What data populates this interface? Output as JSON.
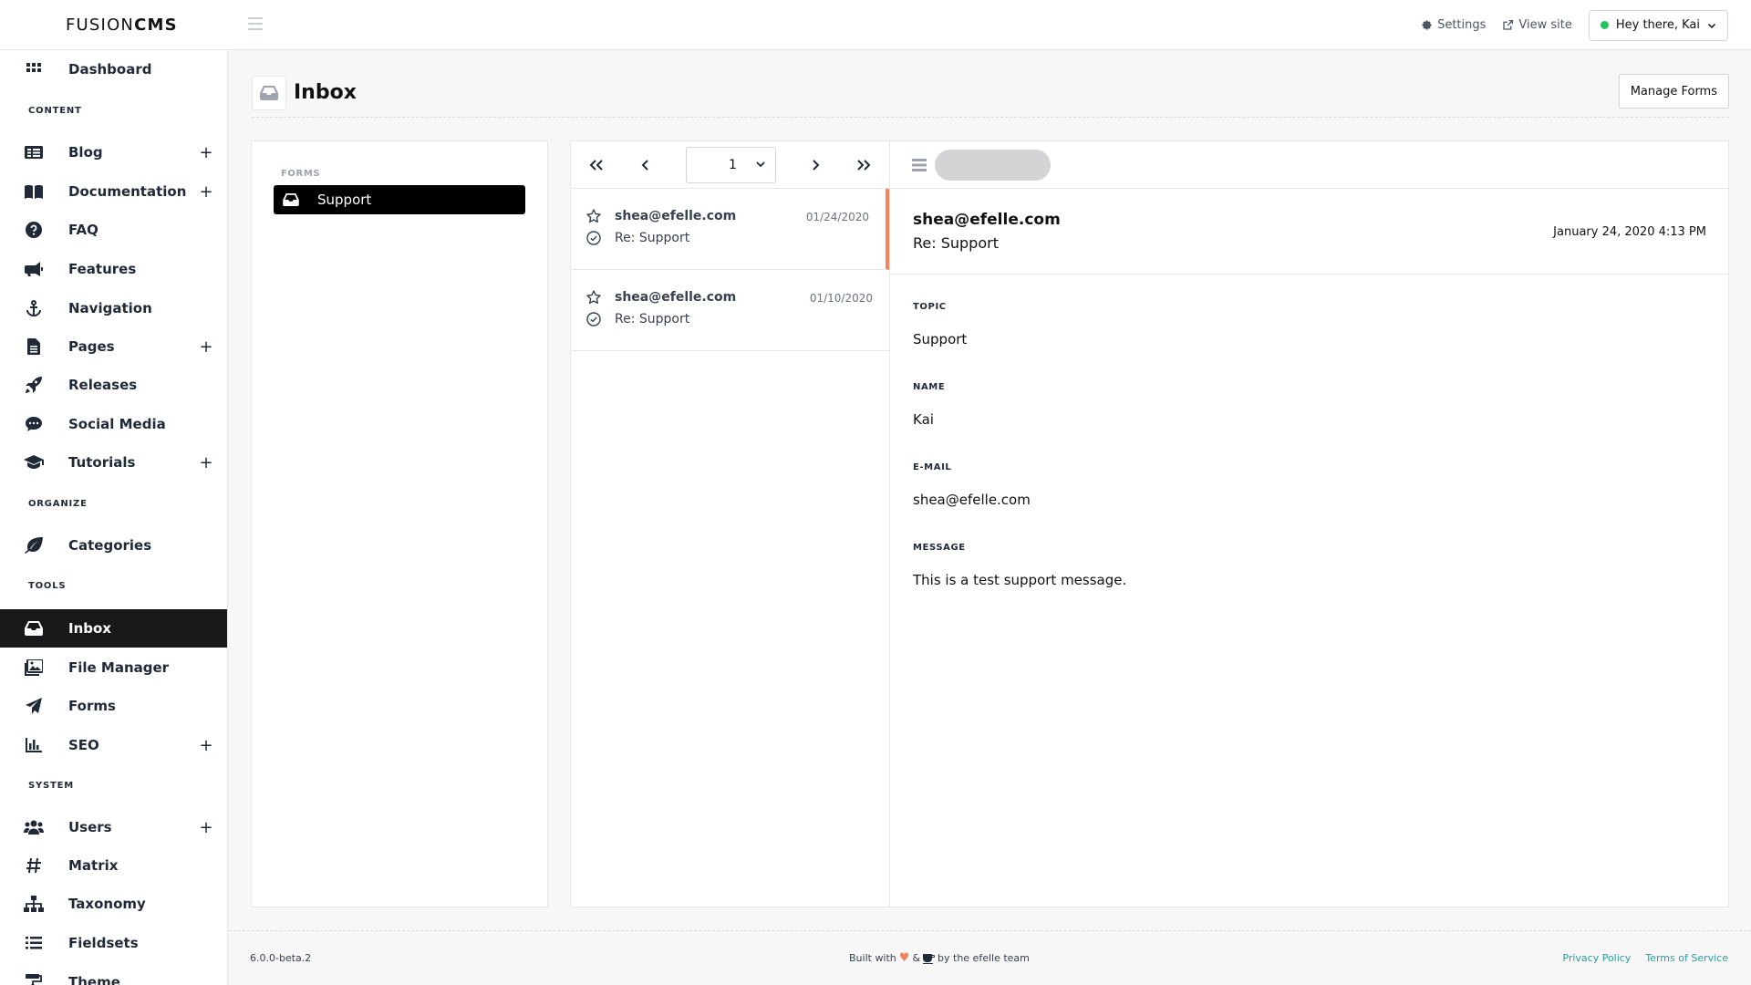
{
  "header": {
    "brand_light": "FUSION",
    "brand_bold": "CMS",
    "settings_label": "Settings",
    "view_site_label": "View site",
    "user_greeting": "Hey there, Kai"
  },
  "sidebar": {
    "dashboard": "Dashboard",
    "sections": {
      "content": "CONTENT",
      "organize": "ORGANIZE",
      "tools": "TOOLS",
      "system": "SYSTEM"
    },
    "content_items": [
      {
        "label": "Blog",
        "icon": "blog-icon",
        "has_add": true
      },
      {
        "label": "Documentation",
        "icon": "book-icon",
        "has_add": true
      },
      {
        "label": "FAQ",
        "icon": "question-icon",
        "has_add": false
      },
      {
        "label": "Features",
        "icon": "megaphone-icon",
        "has_add": false
      },
      {
        "label": "Navigation",
        "icon": "anchor-icon",
        "has_add": false
      },
      {
        "label": "Pages",
        "icon": "file-icon",
        "has_add": true
      },
      {
        "label": "Releases",
        "icon": "rocket-icon",
        "has_add": false
      },
      {
        "label": "Social Media",
        "icon": "comment-icon",
        "has_add": false
      },
      {
        "label": "Tutorials",
        "icon": "graduation-cap-icon",
        "has_add": true
      }
    ],
    "organize_items": [
      {
        "label": "Categories",
        "icon": "leaf-icon"
      }
    ],
    "tools_items": [
      {
        "label": "Inbox",
        "icon": "inbox-icon",
        "active": true
      },
      {
        "label": "File Manager",
        "icon": "images-icon"
      },
      {
        "label": "Forms",
        "icon": "paper-plane-icon"
      },
      {
        "label": "SEO",
        "icon": "chart-bar-icon",
        "has_add": true
      }
    ],
    "system_items": [
      {
        "label": "Users",
        "icon": "users-icon",
        "has_add": true
      },
      {
        "label": "Matrix",
        "icon": "hashtag-icon"
      },
      {
        "label": "Taxonomy",
        "icon": "sitemap-icon"
      },
      {
        "label": "Fieldsets",
        "icon": "list-icon"
      },
      {
        "label": "Theme",
        "icon": "paint-roller-icon"
      }
    ],
    "add_symbol": "+"
  },
  "page": {
    "title": "Inbox",
    "manage_forms_label": "Manage Forms"
  },
  "forms_panel": {
    "heading": "FORMS",
    "items": [
      {
        "label": "Support",
        "selected": true
      }
    ]
  },
  "pager": {
    "current_page": "1"
  },
  "messages": [
    {
      "from": "shea@efelle.com",
      "subject": "Re: Support",
      "date": "01/24/2020",
      "selected": true
    },
    {
      "from": "shea@efelle.com",
      "subject": "Re: Support",
      "date": "01/10/2020",
      "selected": false
    }
  ],
  "detail": {
    "from": "shea@efelle.com",
    "subject": "Re: Support",
    "timestamp": "January 24, 2020 4:13 PM",
    "fields": [
      {
        "label": "TOPIC",
        "value": "Support"
      },
      {
        "label": "NAME",
        "value": "Kai"
      },
      {
        "label": "E-MAIL",
        "value": "shea@efelle.com"
      },
      {
        "label": "MESSAGE",
        "value": "This is a test support message."
      }
    ]
  },
  "footer": {
    "version": "6.0.0-beta.2",
    "built_with": "Built with",
    "ampersand": "&",
    "by_team": "by the efelle team",
    "privacy": "Privacy Policy",
    "terms": "Terms of Service"
  },
  "colors": {
    "accent": "#f4845f",
    "active_nav": "#18181b",
    "link": "#2a9d9d",
    "online": "#22c55e"
  }
}
